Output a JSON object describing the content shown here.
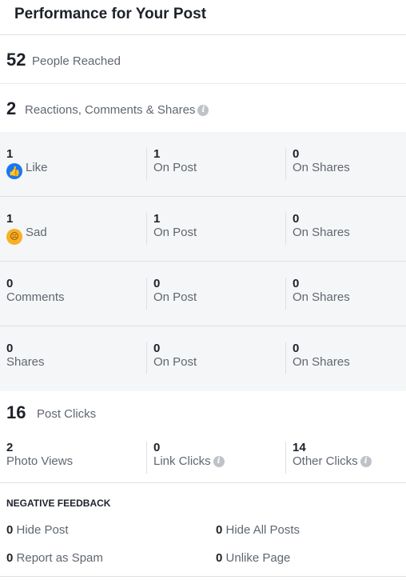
{
  "header": {
    "title": "Performance for Your Post"
  },
  "reach": {
    "value": "52",
    "label": "People Reached"
  },
  "engagement": {
    "value": "2",
    "label": "Reactions, Comments & Shares"
  },
  "rows": [
    {
      "icon": "like-icon",
      "value": "1",
      "label": "Like",
      "on_post_value": "1",
      "on_post_label": "On Post",
      "on_shares_value": "0",
      "on_shares_label": "On Shares"
    },
    {
      "icon": "sad-icon",
      "value": "1",
      "label": "Sad",
      "on_post_value": "1",
      "on_post_label": "On Post",
      "on_shares_value": "0",
      "on_shares_label": "On Shares"
    },
    {
      "value": "0",
      "label": "Comments",
      "on_post_value": "0",
      "on_post_label": "On Post",
      "on_shares_value": "0",
      "on_shares_label": "On Shares"
    },
    {
      "value": "0",
      "label": "Shares",
      "on_post_value": "0",
      "on_post_label": "On Post",
      "on_shares_value": "0",
      "on_shares_label": "On Shares"
    }
  ],
  "post_clicks": {
    "value": "16",
    "label": "Post Clicks"
  },
  "clicks": [
    {
      "value": "2",
      "label": "Photo Views"
    },
    {
      "value": "0",
      "label": "Link Clicks"
    },
    {
      "value": "14",
      "label": "Other Clicks"
    }
  ],
  "negative_feedback": {
    "title": "NEGATIVE FEEDBACK",
    "items": [
      {
        "value": "0",
        "label": "Hide Post"
      },
      {
        "value": "0",
        "label": "Hide All Posts"
      },
      {
        "value": "0",
        "label": "Report as Spam"
      },
      {
        "value": "0",
        "label": "Unlike Page"
      }
    ]
  },
  "info_glyph": "i",
  "colors": {
    "like_blue": "#1877f2",
    "sad_yellow": "#f7b125",
    "grey_bg": "#f5f6f7",
    "muted_text": "#606770"
  }
}
